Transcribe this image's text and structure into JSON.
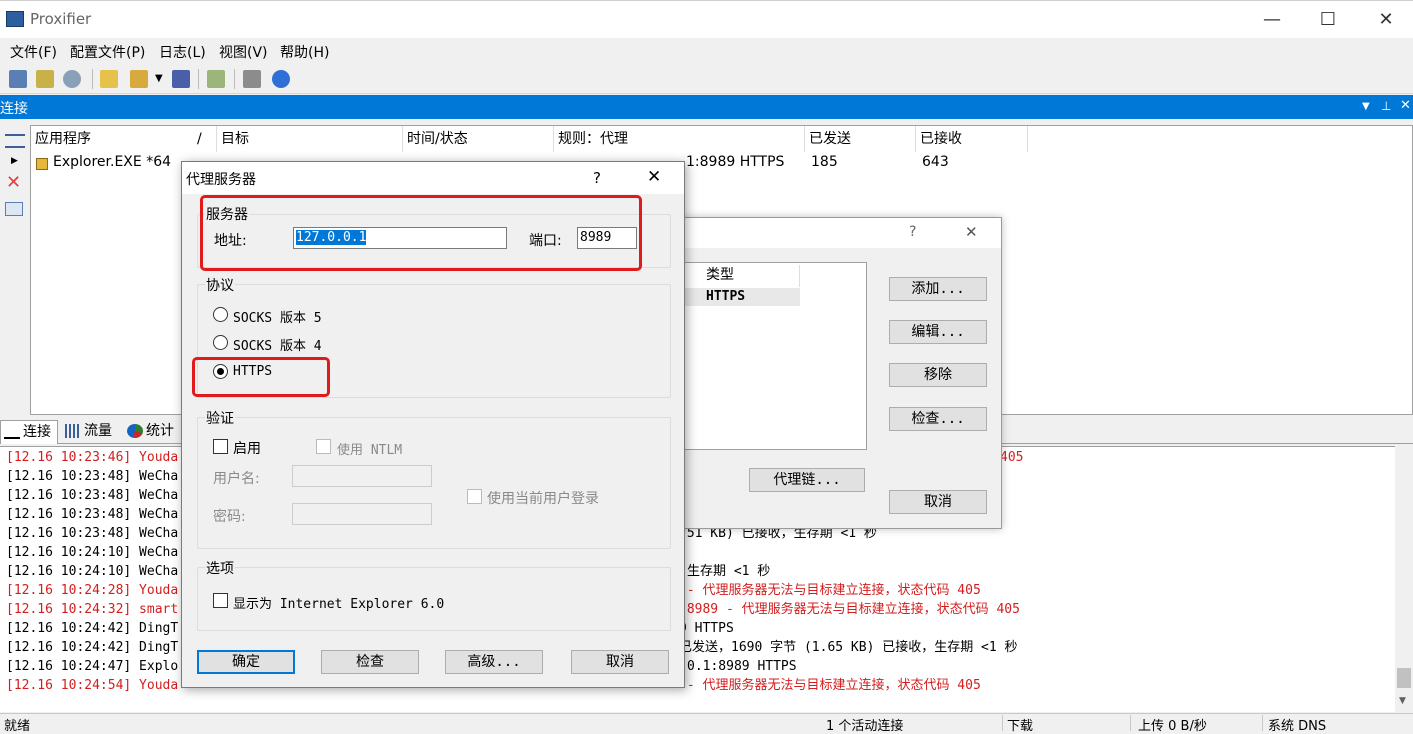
{
  "window": {
    "title": "Proxifier",
    "min": "—",
    "max": "☐",
    "close": "✕"
  },
  "menu": [
    "文件(F)",
    "配置文件(P)",
    "日志(L)",
    "视图(V)",
    "帮助(H)"
  ],
  "pane": {
    "title": "连接"
  },
  "table": {
    "headers": [
      "应用程序",
      "目标",
      "时间/状态",
      "规则：代理",
      "已发送",
      "已接收"
    ],
    "sort_mark": "/",
    "row": {
      "app": "Explorer.EXE *64",
      "rule_tail": "1:8989 HTTPS",
      "sent": "185",
      "received": "643"
    }
  },
  "tabs": [
    "连接",
    "流量",
    "统计"
  ],
  "log": [
    {
      "ts": "[12.16 10:23:46]",
      "app": "Youda",
      "tail": "405",
      "red": true
    },
    {
      "ts": "[12.16 10:23:48]",
      "app": "WeCha",
      "tail": "",
      "red": false
    },
    {
      "ts": "[12.16 10:23:48]",
      "app": "WeCha",
      "tail": "",
      "red": false
    },
    {
      "ts": "[12.16 10:23:48]",
      "app": "WeCha",
      "tail": "",
      "red": false
    },
    {
      "ts": "[12.16 10:23:48]",
      "app": "WeCha",
      "tail": ".51 KB) 已接收，生存期 <1 秒",
      "red": false
    },
    {
      "ts": "[12.16 10:24:10]",
      "app": "WeCha",
      "tail": "",
      "red": false
    },
    {
      "ts": "[12.16 10:24:10]",
      "app": "WeCha",
      "tail": "生存期 <1 秒",
      "red": false
    },
    {
      "ts": "[12.16 10:24:28]",
      "app": "Youda",
      "tail": " - 代理服务器无法与目标建立连接，状态代码 405",
      "red": true
    },
    {
      "ts": "[12.16 10:24:32]",
      "app": "smart",
      "tail": ":8989 - 代理服务器无法与目标建立连接，状态代码 405",
      "red": true
    },
    {
      "ts": "[12.16 10:24:42]",
      "app": "DingT",
      "tail": "9 HTTPS",
      "red": false
    },
    {
      "ts": "[12.16 10:24:42]",
      "app": "DingT",
      "tail": "已发送，1690 字节 (1.65 KB) 已接收，生存期 <1 秒",
      "red": false
    },
    {
      "ts": "[12.16 10:24:47]",
      "app": "Explo",
      "tail": "0.1:8989 HTTPS",
      "red": false
    },
    {
      "ts": "[12.16 10:24:54]",
      "app": "Youda",
      "tail": " - 代理服务器无法与目标建立连接，状态代码 405",
      "red": true
    }
  ],
  "status": {
    "left": "就绪",
    "active": "1 个活动连接",
    "down": "下载",
    "up": "上传 0 B/秒",
    "dns": "系统 DNS"
  },
  "proxies_dialog": {
    "help": "?",
    "close": "✕",
    "list_header": "类型",
    "list_value": "HTTPS",
    "add": "添加...",
    "edit": "编辑...",
    "remove": "移除",
    "check": "检查...",
    "chain": "代理链...",
    "cancel": "取消"
  },
  "proxy_dialog": {
    "title": "代理服务器",
    "help": "?",
    "close": "✕",
    "server_group": "服务器",
    "address_label": "地址:",
    "address_value": "127.0.0.1",
    "port_label": "端口:",
    "port_value": "8989",
    "protocol_group": "协议",
    "socks5": "SOCKS 版本 5",
    "socks4": "SOCKS 版本 4",
    "https": "HTTPS",
    "auth_group": "验证",
    "enable": "启用",
    "ntlm": "使用 NTLM",
    "username": "用户名:",
    "password": "密码:",
    "current_user": "使用当前用户登录",
    "options_group": "选项",
    "ie": "显示为 Internet Explorer 6.0",
    "ok": "确定",
    "check": "检查",
    "advanced": "高级...",
    "cancel": "取消"
  },
  "colors": {
    "accent": "#0078d7",
    "error": "#d21e1e",
    "highlight": "#e01b1b"
  }
}
